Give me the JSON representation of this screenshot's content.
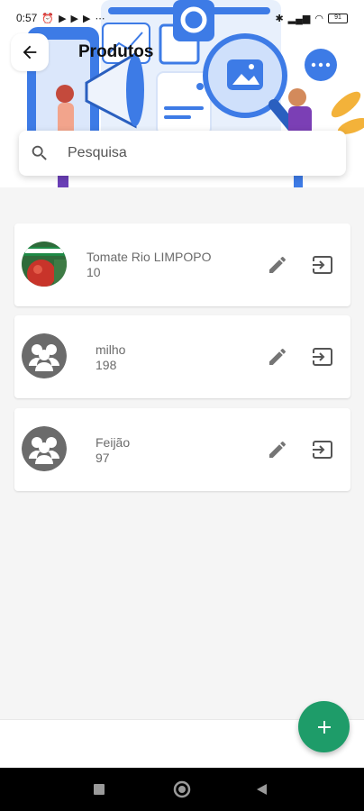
{
  "status_bar": {
    "time": "0:57",
    "battery": "91"
  },
  "header": {
    "title": "Produtos",
    "back_icon": "arrow-left-icon"
  },
  "search": {
    "placeholder": "Pesquisa",
    "value": ""
  },
  "products": [
    {
      "name": "Tomate Rio LIMPOPO",
      "quantity": "10",
      "avatar": "product-photo"
    },
    {
      "name": "milho",
      "quantity": "198",
      "avatar": "group-icon"
    },
    {
      "name": "Feijão",
      "quantity": "97",
      "avatar": "group-icon"
    }
  ],
  "fab": {
    "icon": "plus-icon"
  },
  "colors": {
    "accent": "#1e9c69",
    "icon_gray": "#6b6b6b",
    "illustration_blue": "#3d7be6"
  }
}
